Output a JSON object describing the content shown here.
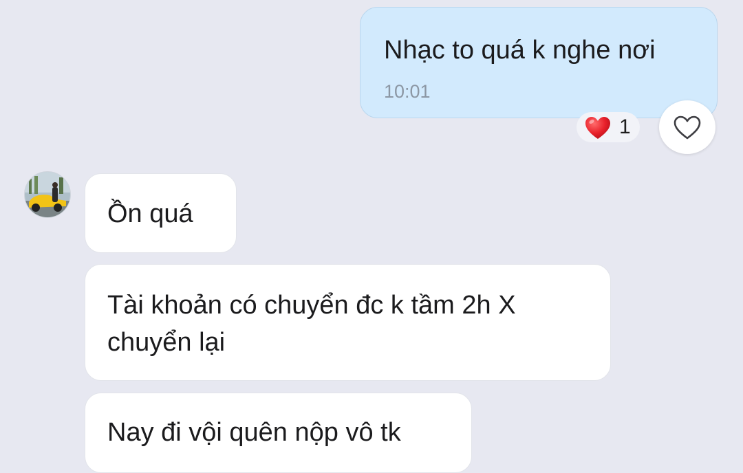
{
  "messages": {
    "outgoing": {
      "text": "Nhạc to quá k nghe nơi",
      "time": "10:01",
      "reaction": {
        "emoji_icon": "heart-icon",
        "color": "#e8202a",
        "count": "1"
      }
    },
    "incoming": [
      {
        "text": "Ồn quá"
      },
      {
        "text": "Tài khoản có chuyển đc k tầm 2h X chuyển lại"
      },
      {
        "text": "Nay đi vội quên nộp vô tk"
      }
    ]
  },
  "colors": {
    "background": "#e7e8f1",
    "outgoing_bubble": "#d2eafd",
    "incoming_bubble": "#ffffff",
    "time_text": "#8c97a4"
  },
  "icons": {
    "like_button": "heart-outline-icon",
    "avatar": "avatar-yellow-car"
  }
}
